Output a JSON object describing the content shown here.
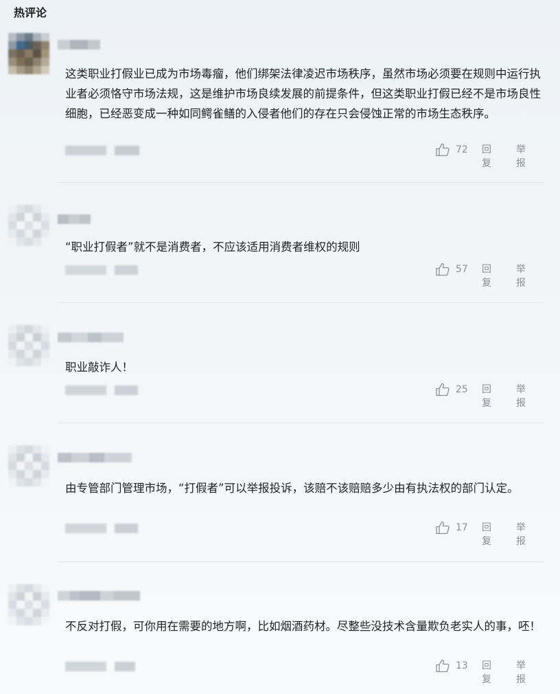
{
  "section_title": "热评论",
  "actions": {
    "reply_label": "回复",
    "report_label": "举报"
  },
  "comments": [
    {
      "text": "这类职业打假业已成为市场毒瘤，他们绑架法律凌迟市场秩序，虽然市场必须要在规则中运行执业者必须恪守市场法规，这是维护市场良续发展的前提条件，但这类职业打假已经不是市场良性细胞，已经恶变成一种如同鳄雀鳝的入侵者他们的存在只会侵蚀正常的市场生态秩序。",
      "likes": "72"
    },
    {
      "text": "“职业打假者”就不是消费者，不应该适用消费者维权的规则",
      "likes": "57"
    },
    {
      "text": "职业敲诈人！",
      "likes": "25"
    },
    {
      "text": "由专管部门管理市场，“打假者”可以举报投诉，该赔不该赔赔多少由有执法权的部门认定。",
      "likes": "17"
    },
    {
      "text": "不反对打假，可你用在需要的地方啊，比如烟酒药材。尽整些没技术含量欺负老实人的事，呸！",
      "likes": "13"
    }
  ]
}
